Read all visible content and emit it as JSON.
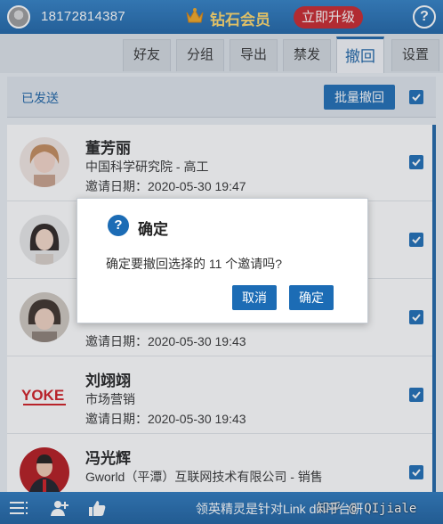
{
  "header": {
    "phone": "18172814387",
    "membership": "钻石会员",
    "upgrade_label": "立即升级",
    "help": "?"
  },
  "tabs": [
    {
      "label": "好友"
    },
    {
      "label": "分组"
    },
    {
      "label": "导出"
    },
    {
      "label": "禁发"
    },
    {
      "label": "撤回",
      "active": true
    },
    {
      "label": "设置"
    }
  ],
  "subbar": {
    "sent_label": "已发送",
    "batch_withdraw_label": "批量撤回"
  },
  "contacts": [
    {
      "name": "董芳丽",
      "org": "中国科学研究院 - 高工",
      "date": "邀请日期：2020-05-30 19:47",
      "checked": true
    },
    {
      "name": "",
      "org": "",
      "date": "",
      "checked": true
    },
    {
      "name": "",
      "org": "",
      "date": "邀请日期：2020-05-30 19:43",
      "checked": true
    },
    {
      "name": "刘翊翊",
      "org": "市场营销",
      "date": "邀请日期：2020-05-30 19:43",
      "checked": true
    },
    {
      "name": "冯光辉",
      "org": "Gworld（平潭）互联网技术有限公司 - 销售",
      "date": "",
      "checked": true
    }
  ],
  "dialog": {
    "title": "确定",
    "message": "确定要撤回选择的 11 个邀请吗?",
    "cancel_label": "取消",
    "ok_label": "确定"
  },
  "footer": {
    "text": "领英精灵是针对Link din平台研"
  },
  "watermark": "知乎 @ QIjiale",
  "colors": {
    "primary": "#1c63a6",
    "upgrade": "#c8242a",
    "gold": "#ffd86b"
  }
}
